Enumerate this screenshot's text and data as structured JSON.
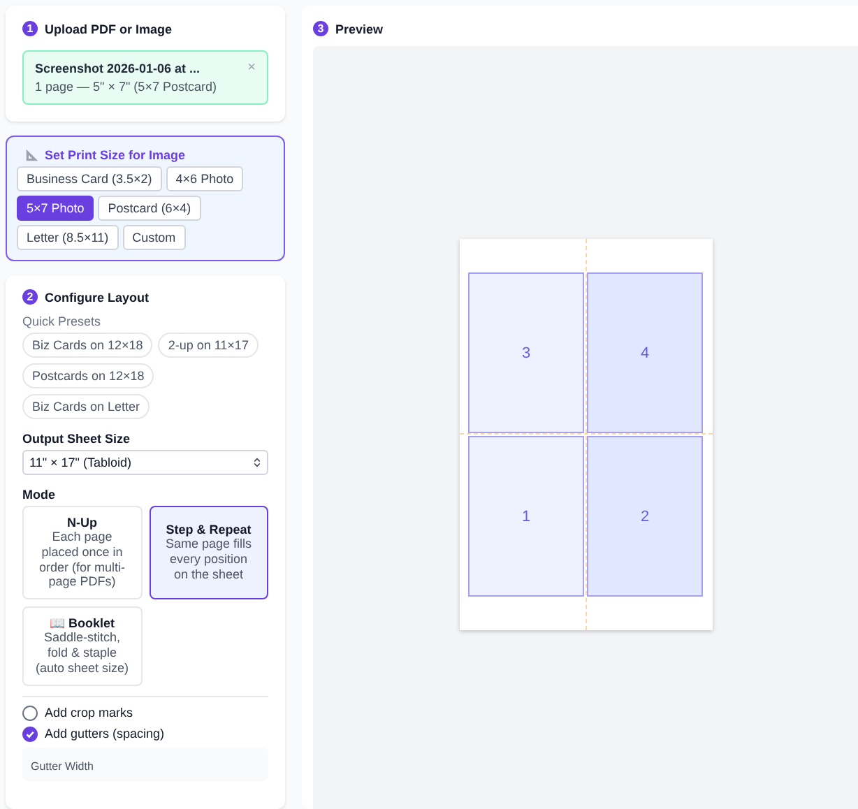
{
  "upload": {
    "step": "1",
    "title": "Upload PDF or Image",
    "file": {
      "name": "Screenshot 2026-01-06 at ...",
      "info": "1 page — 5\" × 7\" (5×7 Postcard)",
      "close": "×"
    }
  },
  "print_size": {
    "title": "Set Print Size for Image",
    "options": [
      {
        "label": "Business Card (3.5×2)",
        "selected": false
      },
      {
        "label": "4×6 Photo",
        "selected": false
      },
      {
        "label": "5×7 Photo",
        "selected": true
      },
      {
        "label": "Postcard (6×4)",
        "selected": false
      },
      {
        "label": "Letter (8.5×11)",
        "selected": false
      },
      {
        "label": "Custom",
        "selected": false
      }
    ]
  },
  "configure": {
    "step": "2",
    "title": "Configure Layout",
    "presets_label": "Quick Presets",
    "presets": [
      "Biz Cards on 12×18",
      "2-up on 11×17",
      "Postcards on 12×18",
      "Biz Cards on Letter"
    ],
    "sheet_label": "Output Sheet Size",
    "sheet_value": "11\" × 17\" (Tabloid)",
    "mode_label": "Mode",
    "modes": [
      {
        "title": "N-Up",
        "desc": "Each page placed once in order (for multi-page PDFs)",
        "selected": false
      },
      {
        "title": "Step & Repeat",
        "desc": "Same page fills every position on the sheet",
        "selected": true
      },
      {
        "title": "Booklet",
        "desc": "Saddle-stitch, fold & staple (auto sheet size)",
        "selected": false,
        "icon": "📖"
      }
    ],
    "checks": [
      {
        "label": "Add crop marks",
        "checked": false
      },
      {
        "label": "Add gutters (spacing)",
        "checked": true
      }
    ],
    "gutter_label": "Gutter Width"
  },
  "preview": {
    "step": "3",
    "title": "Preview",
    "cells": [
      {
        "label": "3",
        "color": "#eef2ff"
      },
      {
        "label": "4",
        "color": "#e0e7ff"
      },
      {
        "label": "1",
        "color": "#eef2ff"
      },
      {
        "label": "2",
        "color": "#e0e7ff"
      }
    ]
  }
}
